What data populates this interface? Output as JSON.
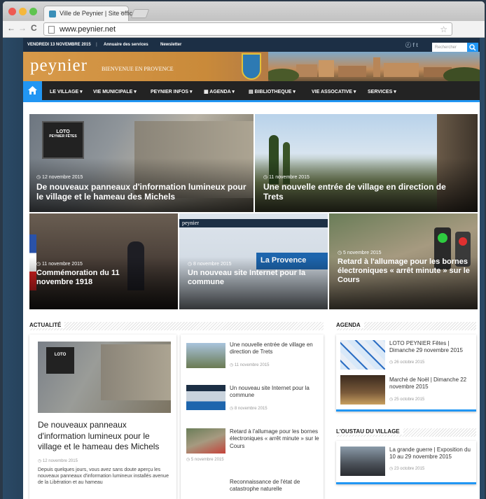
{
  "browser": {
    "tab_title": "Ville de Peynier | Site offic",
    "tab_close": "×",
    "url": "www.peynier.net",
    "back": "←",
    "forward": "→",
    "reload": "C",
    "bookmark_star": "☆"
  },
  "topbar": {
    "date": "VENDREDI 13 NOVEMBRE 2015",
    "separator": "|",
    "link_annuaire": "Annuaire des services",
    "link_newsletter": "Newsletter",
    "search_placeholder": "Rechercher",
    "search_icon": "search-icon"
  },
  "banner": {
    "logo": "peynier",
    "tagline": "BIENVENUE EN PROVENCE"
  },
  "nav": {
    "home_icon": "home-icon",
    "items": [
      "LE VILLAGE ▾",
      "VIE MUNICIPALE ▾",
      "PEYNIER INFOS ▾",
      "▦ AGENDA ▾",
      "▤ BIBLIOTHEQUE ▾",
      "VIE ASSOCATIVE ▾",
      "SERVICES ▾"
    ]
  },
  "slider": [
    {
      "date": "◷ 12 novembre 2015",
      "title": "De nouveaux panneaux d'information lumineux pour le village et le hameau des Michels"
    },
    {
      "date": "◷ 11 novembre 2015",
      "title": "Une nouvelle entrée de village en direction de Trets"
    },
    {
      "date": "◷ 11 novembre 2015",
      "title": "Commémoration du 11 novembre 1918"
    },
    {
      "date": "◷ 8 novembre 2015",
      "title": "Un nouveau site Internet pour la commune"
    },
    {
      "date": "◷ 5 novembre 2015",
      "title": "Retard à l'allumage pour les bornes électroniques « arrêt minute » sur le Cours"
    }
  ],
  "slide_signs": {
    "sign1": "LOTO",
    "sign2": "PEYNIER FÊTES",
    "newspaper": "La Provence",
    "site_logo": "peynier"
  },
  "actualite": {
    "heading": "ACTUALITÉ",
    "featured": {
      "title": "De nouveaux panneaux d'information lumineux pour le village et le hameau des Michels",
      "date": "◷ 12 novembre 2015",
      "excerpt": "Depuis quelques jours, vous avez sans doute aperçu les nouveaux panneaux d'information lumineux installés avenue de la Libération et au hameau"
    },
    "list": [
      {
        "title": "Une nouvelle entrée de village en direction de Trets",
        "date": "◷ 11 novembre 2015"
      },
      {
        "title": "Un nouveau site Internet pour la commune",
        "date": "◷ 8 novembre 2015"
      },
      {
        "title": "Retard à l'allumage pour les bornes électroniques « arrêt minute » sur le Cours",
        "date": "◷ 5 novembre 2015"
      },
      {
        "title": "Reconnaissance de l'état de catastrophe naturelle",
        "date": ""
      }
    ]
  },
  "agenda": {
    "heading": "AGENDA",
    "items": [
      {
        "title": "LOTO PEYNIER Fêtes | Dimanche 29 novembre 2015",
        "date": "◷ 26 octobre 2015"
      },
      {
        "title": "Marché de Noël | Dimanche 22 novembre 2015",
        "date": "◷ 25 octobre 2015"
      }
    ]
  },
  "oustau": {
    "heading": "L'OUSTAU DU VILLAGE",
    "items": [
      {
        "title": "La grande guerre | Exposition du 10 au 29 novembre 2015",
        "date": "◷ 23 octobre 2015"
      }
    ]
  }
}
